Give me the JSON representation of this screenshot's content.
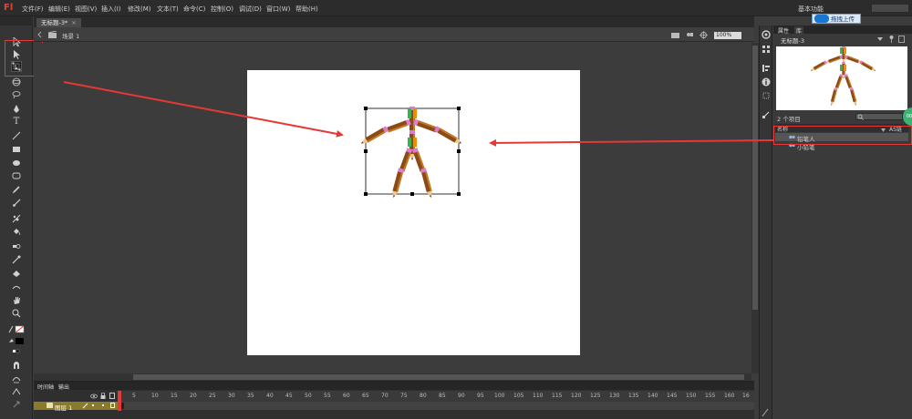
{
  "app": {
    "logo": "Fl"
  },
  "menu": [
    "文件(F)",
    "编辑(E)",
    "视图(V)",
    "插入(I)",
    "修改(M)",
    "文本(T)",
    "命令(C)",
    "控制(O)",
    "调试(D)",
    "窗口(W)",
    "帮助(H)"
  ],
  "workspace": {
    "label": "基本功能",
    "upload_tip": "拖拽上传"
  },
  "document": {
    "tab_title": "无标题-3*",
    "close": "×",
    "scene": "场景 1",
    "zoom": "100%"
  },
  "timeline": {
    "tabs": [
      "时间轴",
      "输出"
    ],
    "layer_name": "图层 1",
    "frame_numbers": [
      "5",
      "10",
      "15",
      "20",
      "25",
      "30",
      "35",
      "40",
      "45",
      "50",
      "55",
      "60",
      "65",
      "70",
      "75",
      "80",
      "85",
      "90",
      "95",
      "100",
      "105",
      "110",
      "115",
      "120",
      "125",
      "130",
      "135",
      "140",
      "145",
      "150",
      "155",
      "160",
      "16"
    ]
  },
  "library": {
    "tabs": [
      "属性",
      "库"
    ],
    "document_name": "无标题-3",
    "item_count": "2 个项目",
    "col_name": "名称",
    "col_linkage": "AS链",
    "items": [
      {
        "label": "铅笔人",
        "selected": true
      },
      {
        "label": "小铅笔",
        "selected": false
      }
    ]
  },
  "badges": {
    "green": "00"
  },
  "colors": {
    "highlight": "#e53935",
    "stage": "#ffffff",
    "layer": "#8a7a2e",
    "upload": "#1976d2"
  },
  "icons": [
    "selection-tool-icon",
    "subselection-tool-icon",
    "free-transform-tool-icon",
    "3d-rotation-tool-icon",
    "lasso-tool-icon",
    "pen-tool-icon",
    "text-tool-icon",
    "line-tool-icon",
    "rectangle-tool-icon",
    "oval-tool-icon",
    "primitive-tool-icon",
    "pencil-tool-icon",
    "brush-tool-icon",
    "deco-tool-icon",
    "bone-tool-icon",
    "paint-bucket-icon",
    "eyedropper-icon",
    "eraser-icon",
    "width-tool-icon",
    "hand-tool-icon",
    "zoom-tool-icon",
    "stroke-color-icon",
    "fill-color-icon"
  ]
}
